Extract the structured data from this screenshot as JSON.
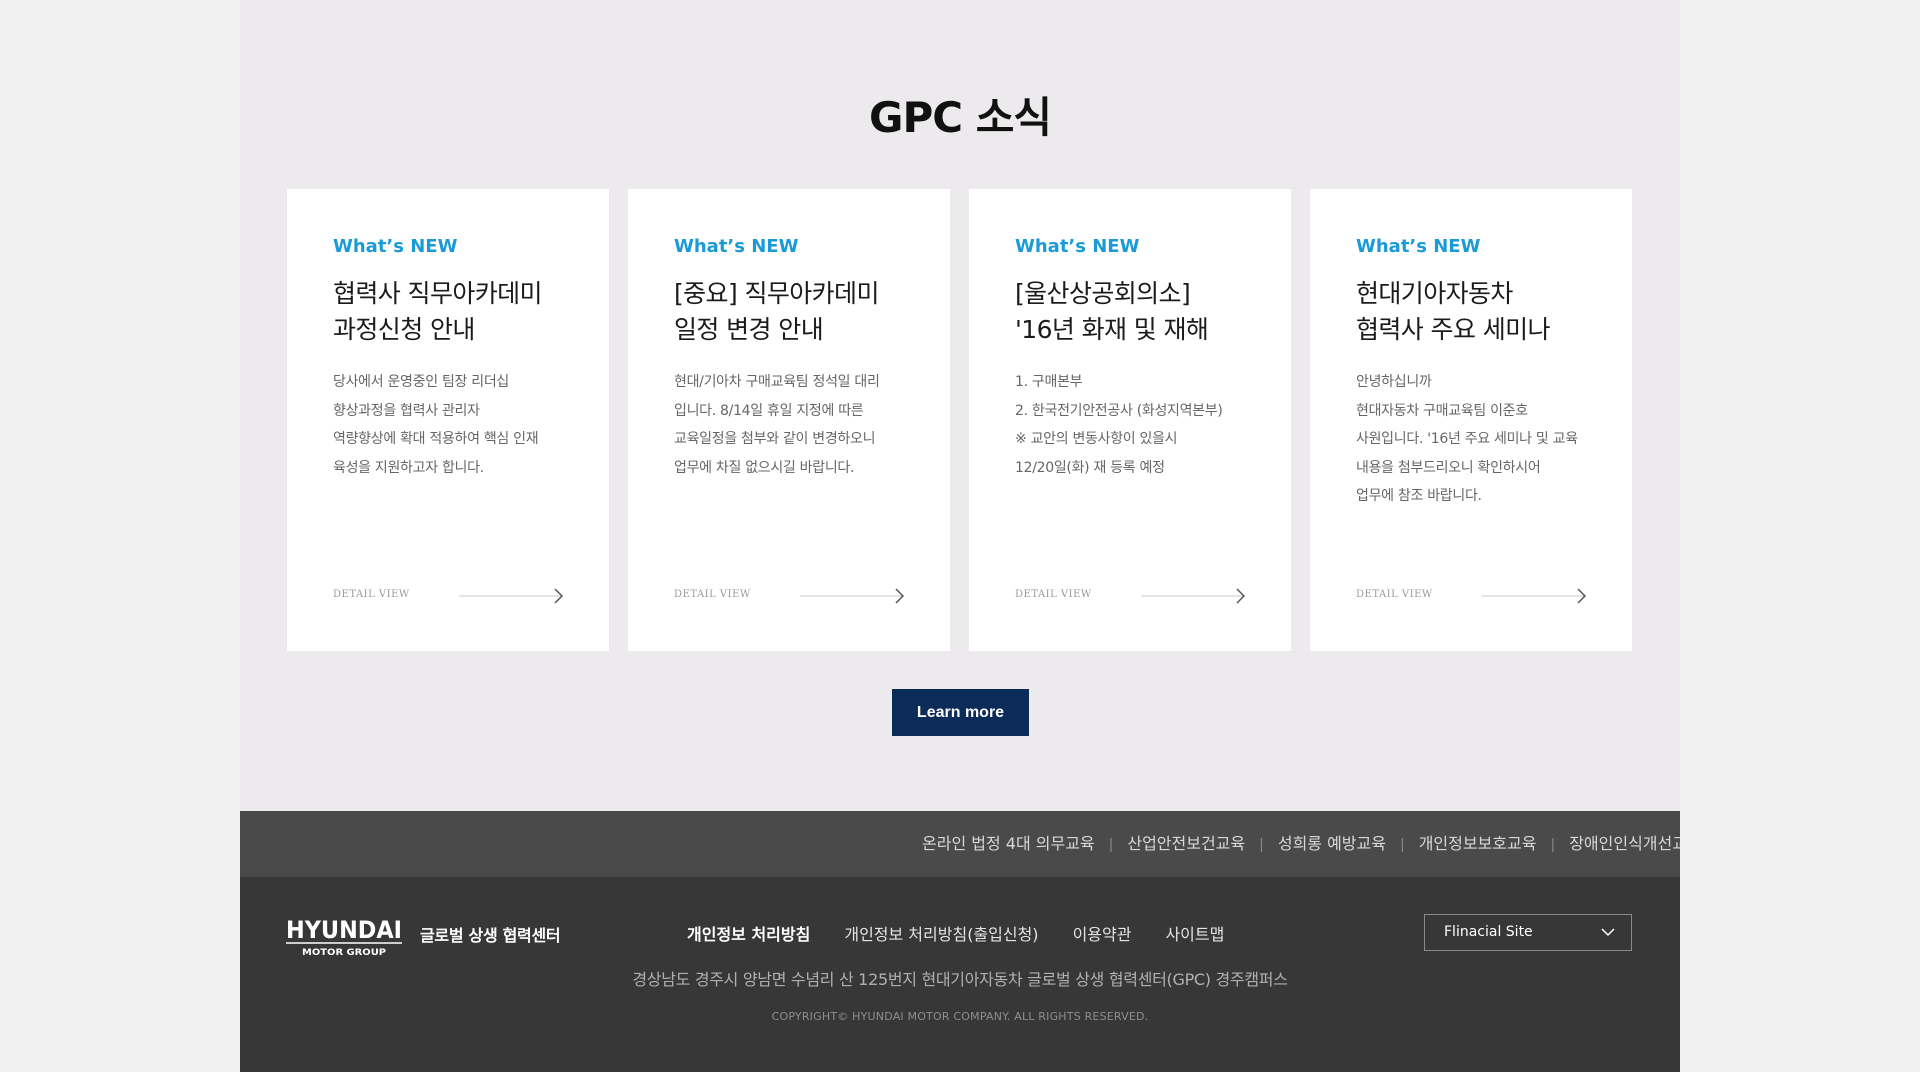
{
  "news": {
    "title": "GPC 소식",
    "cards": [
      {
        "tag": "What’s NEW",
        "heading": [
          "협력사 직무아카데미",
          "과정신청 안내"
        ],
        "body": [
          "당사에서 운영중인 팀장 리더십",
          "향상과정을 협력사 관리자",
          "역량향상에 확대 적용하여 핵심 인재",
          "육성을 지원하고자 합니다."
        ],
        "detail": "DETAIL VIEW"
      },
      {
        "tag": "What’s NEW",
        "heading": [
          "[중요] 직무아카데미",
          "일정 변경 안내"
        ],
        "body": [
          "현대/기아차 구매교육팀 정석일 대리",
          "입니다. 8/14일 휴일 지정에 따른",
          "교육일정을 첨부와 같이 변경하오니",
          "업무에 차질 없으시길 바랍니다."
        ],
        "detail": "DETAIL VIEW"
      },
      {
        "tag": "What’s NEW",
        "heading": [
          "[울산상공회의소]",
          "'16년 화재 및 재해"
        ],
        "body": [
          "1. 구매본부",
          "2. 한국전기안전공사 (화성지역본부)",
          "※ 교안의 변동사항이 있을시",
          "12/20일(화) 재 등록 예정"
        ],
        "detail": "DETAIL VIEW"
      },
      {
        "tag": "What’s NEW",
        "heading": [
          "현대기아자동차",
          "협력사 주요 세미나"
        ],
        "body": [
          "안녕하십니까",
          "현대자동차 구매교육팀 이준호",
          "사원입니다. '16년 주요 세미나 및 교육",
          "내용을 첨부드리오니 확인하시어",
          "업무에 참조 바랍니다."
        ],
        "detail": "DETAIL VIEW"
      }
    ],
    "learn_more": "Learn more"
  },
  "quick_links": [
    "온라인 법정 4대 의무교육",
    "산업안전보건교육",
    "성희롱 예방교육",
    "개인정보보호교육",
    "장애인인식개선교육"
  ],
  "quick_separator": "|",
  "footer": {
    "logo_main": "HYUNDAI",
    "logo_sub": "MOTOR GROUP",
    "center_name": "글로벌 상생 협력센터",
    "links": [
      "개인정보 처리방침",
      "개인정보 처리방침(출입신청)",
      "이용약관",
      "사이트맵"
    ],
    "address": "경상남도 경주시 양남면 수념리 산 125번지 현대기아자동차 글로벌 상생 협력센터(GPC) 경주캠퍼스",
    "copyright": "COPYRIGHT© HYUNDAI MOTOR COMPANY. ALL RIGHTS RESERVED.",
    "site_select": "Flinacial Site"
  },
  "colors": {
    "accent": "#1a9ad6",
    "button_bg": "#0b2b59",
    "quick_bar_bg": "#4a4a4a",
    "footer_bg": "#373737",
    "section_bg": "#edeaee"
  },
  "icons": {
    "detail_arrow": "arrow-right-icon",
    "select_chevron": "chevron-down-icon"
  }
}
